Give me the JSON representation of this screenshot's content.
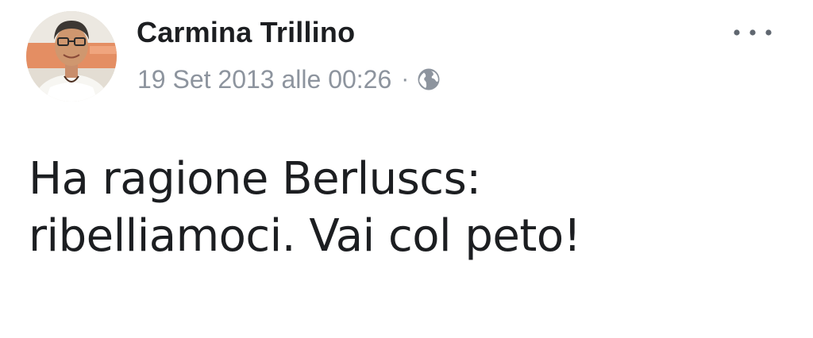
{
  "post": {
    "author": {
      "name": "Carmina Trillino"
    },
    "timestamp": "19 Set 2013 alle 00:26",
    "separator": "·",
    "privacy_icon": "globe-icon",
    "more_icon": "more-options-icon",
    "text_lines": [
      "Ha ragione Berluscs:",
      "ribelliamoci. Vai col peto!"
    ]
  },
  "colors": {
    "name": "#1c1e21",
    "meta": "#8d949e",
    "body_text": "#1c1e21",
    "background": "#ffffff"
  }
}
